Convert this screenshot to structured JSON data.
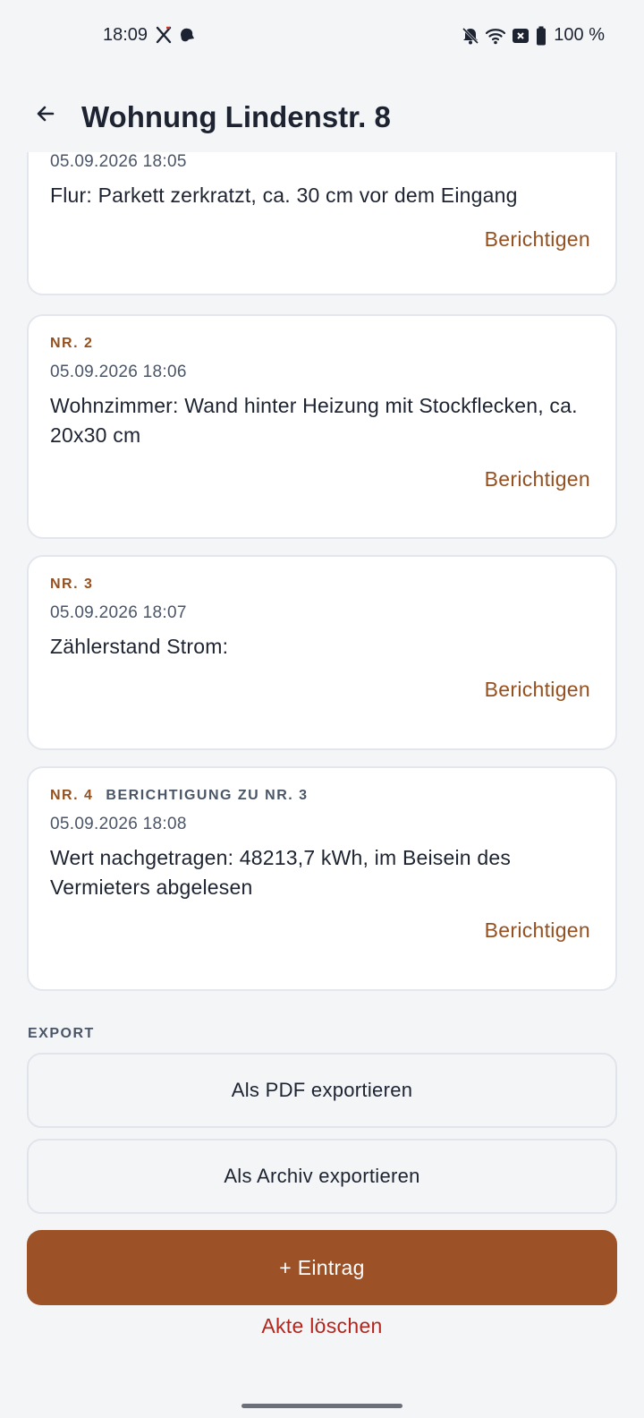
{
  "status_bar": {
    "time": "18:09",
    "battery_text": "100 %",
    "icons": [
      "x-app-icon",
      "notification-app-icon",
      "bell-off-icon",
      "wifi-icon",
      "sim-x-icon",
      "battery-icon"
    ]
  },
  "header": {
    "title": "Wohnung Lindenstr. 8",
    "back_icon": "arrow-left-icon"
  },
  "entries": [
    {
      "number": "",
      "correction_of": "",
      "timestamp": "05.09.2026 18:05",
      "text": "Flur: Parkett zerkratzt, ca. 30 cm vor dem Eingang",
      "action": "Berichtigen"
    },
    {
      "number": "NR. 2",
      "correction_of": "",
      "timestamp": "05.09.2026 18:06",
      "text": "Wohnzimmer: Wand hinter Heizung mit Stockflecken, ca. 20x30 cm",
      "action": "Berichtigen"
    },
    {
      "number": "NR. 3",
      "correction_of": "",
      "timestamp": "05.09.2026 18:07",
      "text": "Zählerstand Strom:",
      "action": "Berichtigen"
    },
    {
      "number": "NR. 4",
      "correction_of": "BERICHTIGUNG ZU NR. 3",
      "timestamp": "05.09.2026 18:08",
      "text": "Wert nachgetragen: 48213,7 kWh, im Beisein des Vermieters abgelesen",
      "action": "Berichtigen"
    }
  ],
  "export": {
    "section_label": "EXPORT",
    "pdf_label": "Als PDF exportieren",
    "archive_label": "Als Archiv exportieren"
  },
  "actions": {
    "add_entry_label": "+ Eintrag",
    "delete_label": "Akte löschen"
  },
  "colors": {
    "accent": "#9c5127",
    "accent_text": "#96501f",
    "danger": "#b3261e",
    "background": "#f4f5f7",
    "card": "#ffffff"
  }
}
